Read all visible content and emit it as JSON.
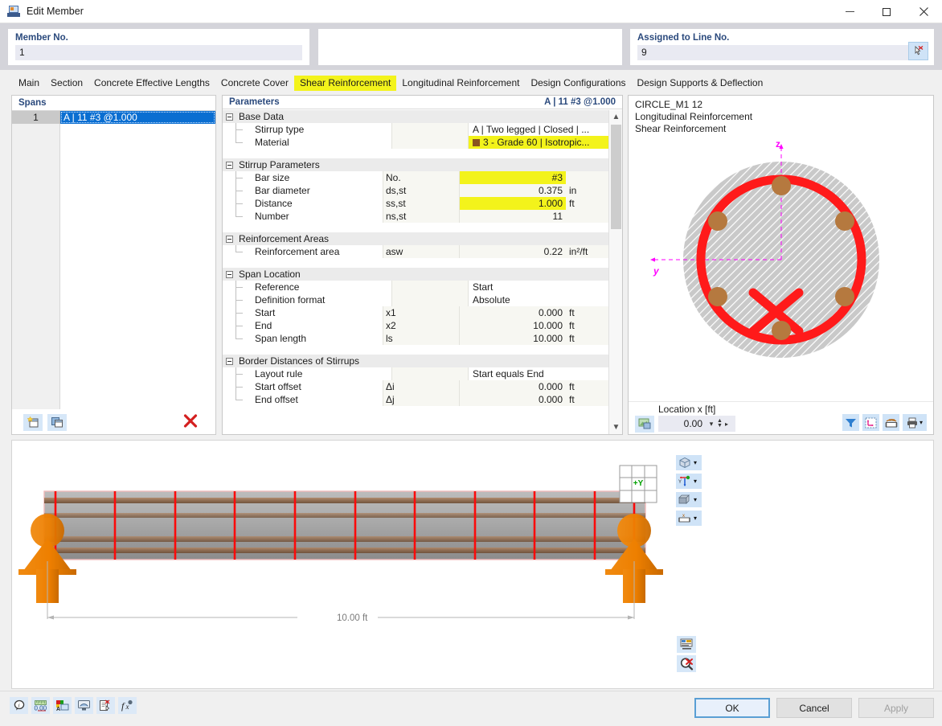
{
  "window": {
    "title": "Edit Member",
    "app_icon": "member-icon",
    "controls": {
      "minimize": "–",
      "maximize": "□",
      "close": "✕"
    }
  },
  "header": {
    "member_no": {
      "label": "Member No.",
      "value": "1"
    },
    "middle": {
      "label": "",
      "value": ""
    },
    "assigned_line": {
      "label": "Assigned to Line No.",
      "value": "9",
      "pick_icon": "pick-line-icon"
    }
  },
  "tabs": [
    {
      "label": "Main",
      "active": false
    },
    {
      "label": "Section",
      "active": false
    },
    {
      "label": "Concrete Effective Lengths",
      "active": false
    },
    {
      "label": "Concrete Cover",
      "active": false
    },
    {
      "label": "Shear Reinforcement",
      "active": true
    },
    {
      "label": "Longitudinal Reinforcement",
      "active": false
    },
    {
      "label": "Design Configurations",
      "active": false
    },
    {
      "label": "Design Supports & Deflection",
      "active": false
    }
  ],
  "spans": {
    "title": "Spans",
    "rows": [
      {
        "no": "1",
        "description": "A | 11 #3 @1.000"
      }
    ],
    "toolbar": {
      "new_icon": "new-item-icon",
      "copy_icon": "copy-item-icon",
      "delete_icon": "delete-icon"
    }
  },
  "parameters": {
    "title": "Parameters",
    "header_value": "A | 11 #3 @1.000",
    "groups": [
      {
        "name": "Base Data",
        "rows": [
          {
            "label": "Stirrup type",
            "symbol": "",
            "value": "A | Two legged | Closed | ...",
            "unit": "",
            "highlight": false,
            "value_left": true
          },
          {
            "label": "Material",
            "symbol": "",
            "value": "3 - Grade 60 | Isotropic...",
            "unit": "",
            "highlight": true,
            "value_left": true,
            "swatch": "#8a5520"
          }
        ]
      },
      {
        "name": "Stirrup Parameters",
        "rows": [
          {
            "label": "Bar size",
            "symbol": "No.",
            "value": "#3",
            "unit": "",
            "highlight": true
          },
          {
            "label": "Bar diameter",
            "symbol": "ds,st",
            "value": "0.375",
            "unit": "in",
            "highlight": false
          },
          {
            "label": "Distance",
            "symbol": "ss,st",
            "value": "1.000",
            "unit": "ft",
            "highlight": true
          },
          {
            "label": "Number",
            "symbol": "ns,st",
            "value": "11",
            "unit": "",
            "highlight": false
          }
        ]
      },
      {
        "name": "Reinforcement Areas",
        "rows": [
          {
            "label": "Reinforcement area",
            "symbol": "asw",
            "value": "0.22",
            "unit": "in²/ft",
            "highlight": false
          }
        ]
      },
      {
        "name": "Span Location",
        "rows": [
          {
            "label": "Reference",
            "symbol": "",
            "value": "Start",
            "unit": "",
            "highlight": false,
            "value_left": true
          },
          {
            "label": "Definition format",
            "symbol": "",
            "value": "Absolute",
            "unit": "",
            "highlight": false,
            "value_left": true
          },
          {
            "label": "Start",
            "symbol": "x1",
            "value": "0.000",
            "unit": "ft",
            "highlight": false
          },
          {
            "label": "End",
            "symbol": "x2",
            "value": "10.000",
            "unit": "ft",
            "highlight": false
          },
          {
            "label": "Span length",
            "symbol": "ls",
            "value": "10.000",
            "unit": "ft",
            "highlight": false
          }
        ]
      },
      {
        "name": "Border Distances of Stirrups",
        "rows": [
          {
            "label": "Layout rule",
            "symbol": "",
            "value": "Start equals End",
            "unit": "",
            "highlight": false,
            "value_left": true
          },
          {
            "label": "Start offset",
            "symbol": "Δi",
            "value": "0.000",
            "unit": "ft",
            "highlight": false
          },
          {
            "label": "End offset",
            "symbol": "Δj",
            "value": "0.000",
            "unit": "ft",
            "highlight": false
          }
        ]
      }
    ]
  },
  "section_panel": {
    "captions": [
      "CIRCLE_M1 12",
      "Longitudinal Reinforcement",
      "Shear Reinforcement"
    ],
    "axis_z": "z",
    "axis_y": "y",
    "location": {
      "label": "Location x [ft]",
      "value": "0.00"
    },
    "image_button_icon": "image-export-icon",
    "tools": [
      {
        "icon": "filter-icon"
      },
      {
        "icon": "axis-system-icon"
      },
      {
        "icon": "dimensions-icon"
      },
      {
        "icon": "print-icon"
      }
    ],
    "cross_section": {
      "concrete_fill": "#c9c9c9",
      "stirrup_color": "#ff1a1a",
      "rebar_color": "#b5793f",
      "axis_color": "#ff00ff",
      "rebar_count": 6
    }
  },
  "view3d": {
    "dimension_label": "10.00 ft",
    "viewcube_label": "+Y",
    "colors": {
      "stirrup": "#fb0a0a",
      "longitudinal_bar": "#9a7358",
      "concrete": "#a8a8a8",
      "support": "#ee7f00"
    },
    "tools": [
      {
        "icon": "render-mode-icon"
      },
      {
        "icon": "axes-visibility-icon"
      },
      {
        "icon": "solid-view-icon"
      },
      {
        "icon": "dimension-icon"
      }
    ],
    "bottom_tools": [
      {
        "icon": "show-results-icon"
      },
      {
        "icon": "zoom-clear-icon"
      }
    ]
  },
  "bottombar": {
    "icons": [
      {
        "icon": "info-icon"
      },
      {
        "icon": "units-icon"
      },
      {
        "icon": "display-properties-icon"
      },
      {
        "icon": "visual-settings-icon"
      },
      {
        "icon": "comment-icon"
      },
      {
        "icon": "formula-icon"
      }
    ],
    "buttons": [
      {
        "label": "OK",
        "state": "primary"
      },
      {
        "label": "Cancel",
        "state": "normal"
      },
      {
        "label": "Apply",
        "state": "disabled"
      }
    ]
  }
}
